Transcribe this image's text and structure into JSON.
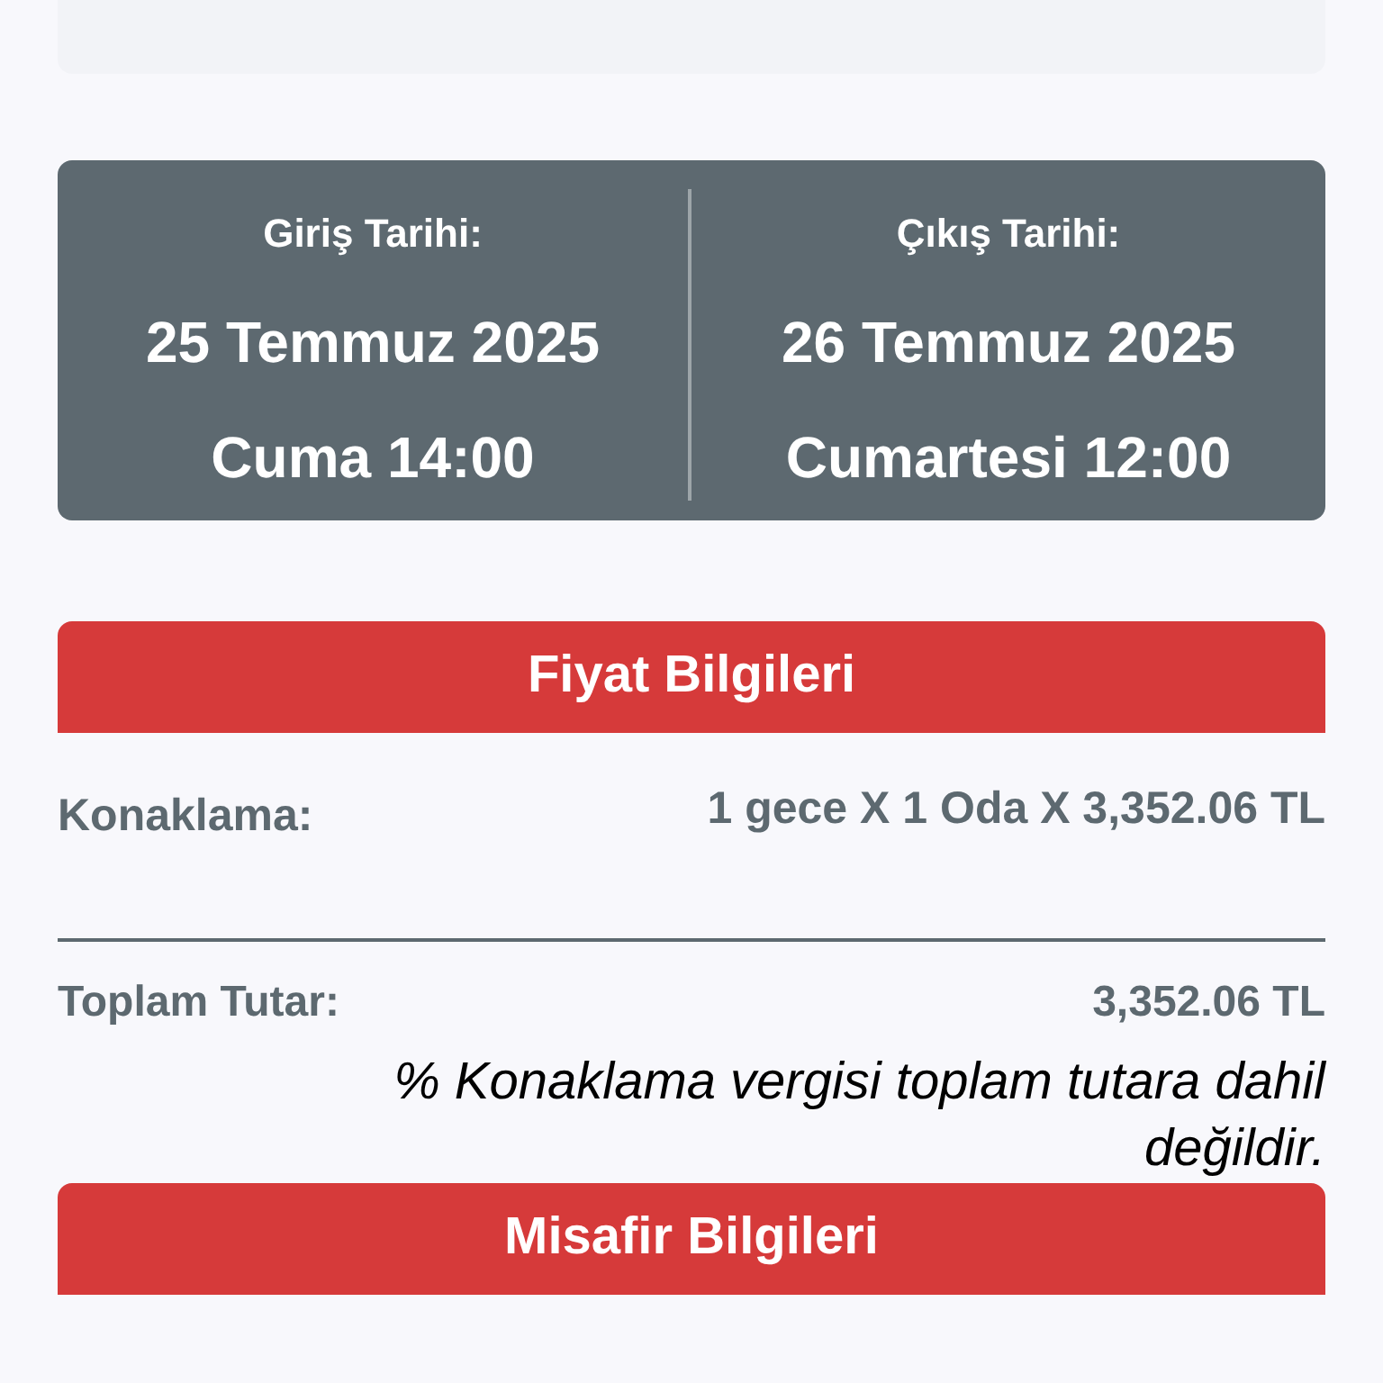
{
  "dates": [
    {
      "label": "Giriş Tarihi:",
      "date": "25 Temmuz 2025",
      "day_time": "Cuma 14:00"
    },
    {
      "label": "Çıkış Tarihi:",
      "date": "26 Temmuz 2025",
      "day_time": "Cumartesi 12:00"
    }
  ],
  "price_section": {
    "title": "Fiyat Bilgileri",
    "rows": [
      {
        "label": "Konaklama:",
        "value": "1 gece X 1 Oda X 3,352.06 TL"
      }
    ],
    "total": {
      "label": "Toplam Tutar:",
      "value": "3,352.06 TL"
    },
    "note": "% Konaklama vergisi toplam tutara dahil değildir."
  },
  "guest_section": {
    "title": "Misafir Bilgileri"
  }
}
